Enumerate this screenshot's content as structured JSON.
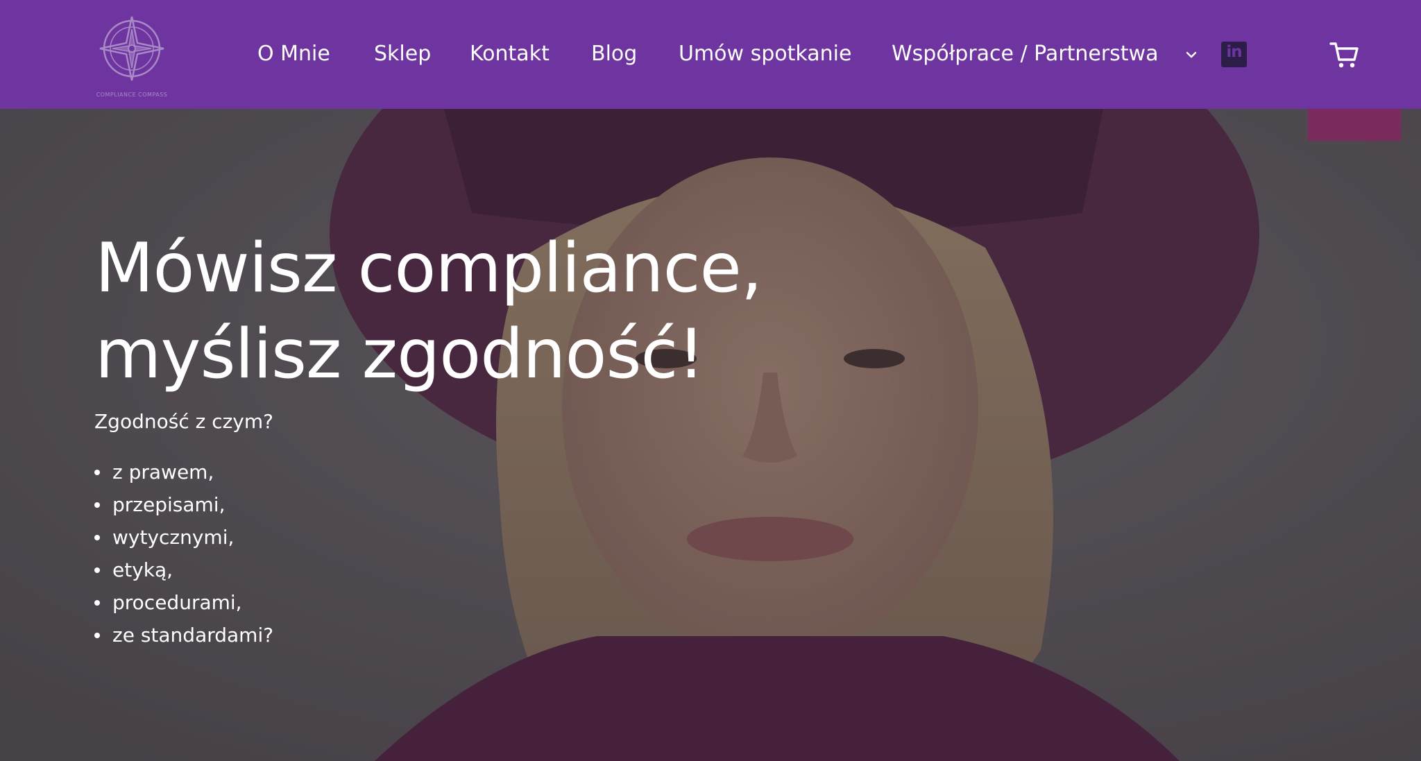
{
  "brand": {
    "logo_icon": "compass-rose-icon",
    "logo_text": "COMPLIANCE COMPASS"
  },
  "nav": {
    "items": [
      {
        "label": "O Mnie"
      },
      {
        "label": "Sklep"
      },
      {
        "label": "Kontakt"
      },
      {
        "label": "Blog"
      },
      {
        "label": "Umów spotkanie"
      },
      {
        "label": "Współprace / Partnerstwa"
      }
    ],
    "submenu_icon": "chevron-down-icon",
    "social_icon": "linkedin-icon",
    "social_label": "in",
    "cart_icon": "cart-icon"
  },
  "hero": {
    "title_line1": "Mówisz compliance,",
    "title_line2": "myślisz zgodność!",
    "question": "Zgodność z czym?",
    "list": [
      "z prawem,",
      "przepisami,",
      "wytycznymi,",
      "etyką,",
      "procedurami,",
      "ze standardami?"
    ]
  },
  "colors": {
    "header_bg": "#6e35a0",
    "accent": "#7a2a5c",
    "text": "#ffffff",
    "overlay": "#3f3b40"
  }
}
